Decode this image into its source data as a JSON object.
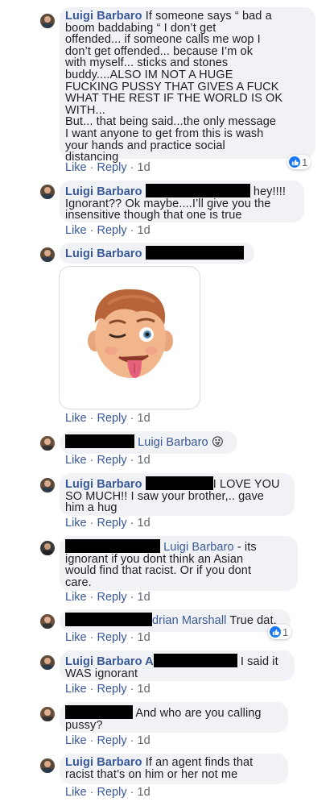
{
  "actions": {
    "like": "Like",
    "reply": "Reply",
    "sep": "·",
    "time": "1d"
  },
  "comments": [
    {
      "author": "Luigi Barbaro",
      "text": " If someone says “ bad a\nboom baddabing “ I don’t get\noffended... if someone calls me wop I\ndon’t get offended... because I’m ok\nwith myself... sticks and stones\nbuddy....ALSO IM NOT A HUGE\nFUCKING PUSSY THAT GIVES A FUCK\nWHAT THE REST IF THE WORLD IS OK\nWITH...\nBut... that being said...the only message\nI want anyone to get from this is wash\nyour hands and practice social\ndistancing",
      "reaction_count": "1"
    },
    {
      "author": "Luigi Barbaro",
      "text_after_redaction": " hey!!!!",
      "text_rest": "Ignorant?? Ok maybe....I’ll give you the\ninsensitive though that one is true"
    },
    {
      "author": "Luigi Barbaro",
      "sticker": "winking-emoji-sticker"
    },
    {
      "mention": "Luigi Barbaro",
      "emoji": "😜"
    },
    {
      "author": "Luigi Barbaro",
      "text_after_redaction": "I LOVE YOU",
      "text_rest": "SO MUCH!! I saw your brother,.. gave\nhim a hug"
    },
    {
      "mention": "Luigi Barbaro",
      "text_after_mention": " - its",
      "text_rest": "ignorant if you dont think an Asian\nwould find that racist. Or if you dont\ncare."
    },
    {
      "mention_partial": "drian Marshall",
      "text_after_mention": " True dat.",
      "reaction_count": "1"
    },
    {
      "author": "Luigi Barbaro",
      "author_suffix": " A",
      "text_after_redaction": " I said it",
      "text_rest": "WAS ignorant"
    },
    {
      "text_after_redaction": "And who are you calling",
      "text_rest": "pussy?"
    },
    {
      "author": "Luigi Barbaro",
      "text": " If an agent finds that\nracist that’s on him or her not me"
    }
  ]
}
